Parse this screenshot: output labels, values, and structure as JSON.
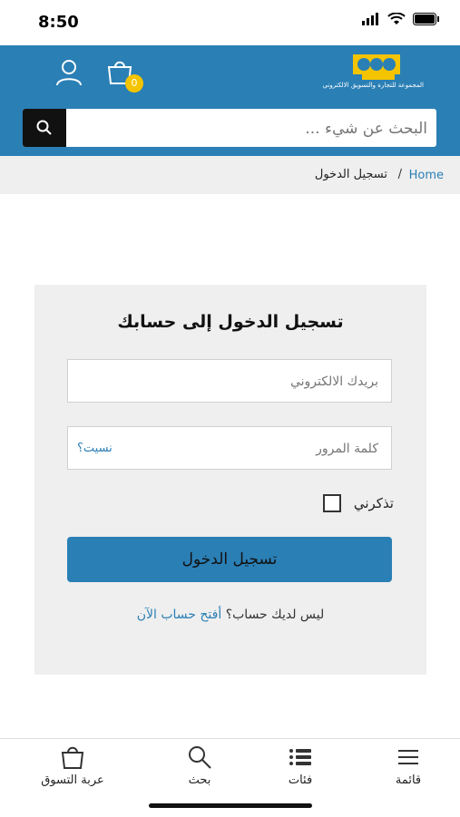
{
  "status": {
    "time": "8:50"
  },
  "header": {
    "logo_text": "المجموعة للتجارة والتسويق الالكتروني",
    "cart_count": "0",
    "brand_color": "#2a7fb5"
  },
  "search": {
    "placeholder": "البحث عن شيء ..."
  },
  "breadcrumb": {
    "home": "Home",
    "separator": "/",
    "current": "تسجيل الدخول"
  },
  "login": {
    "title": "تسجيل الدخول إلى حسابك",
    "email_placeholder": "بريدك الالكتروني",
    "password_placeholder": "كلمة المرور",
    "forgot_label": "نسيت؟",
    "remember_label": "تذكرني",
    "submit_label": "تسجيل الدخول",
    "no_account_text": "ليس لديك حساب؟",
    "create_account_link": "أفتح حساب الآن"
  },
  "tabs": [
    {
      "label": "قائمة",
      "icon": "menu-icon"
    },
    {
      "label": "فئات",
      "icon": "categories-icon"
    },
    {
      "label": "بحث",
      "icon": "search-icon"
    },
    {
      "label": "عربة التسوق",
      "icon": "cart-icon"
    }
  ]
}
